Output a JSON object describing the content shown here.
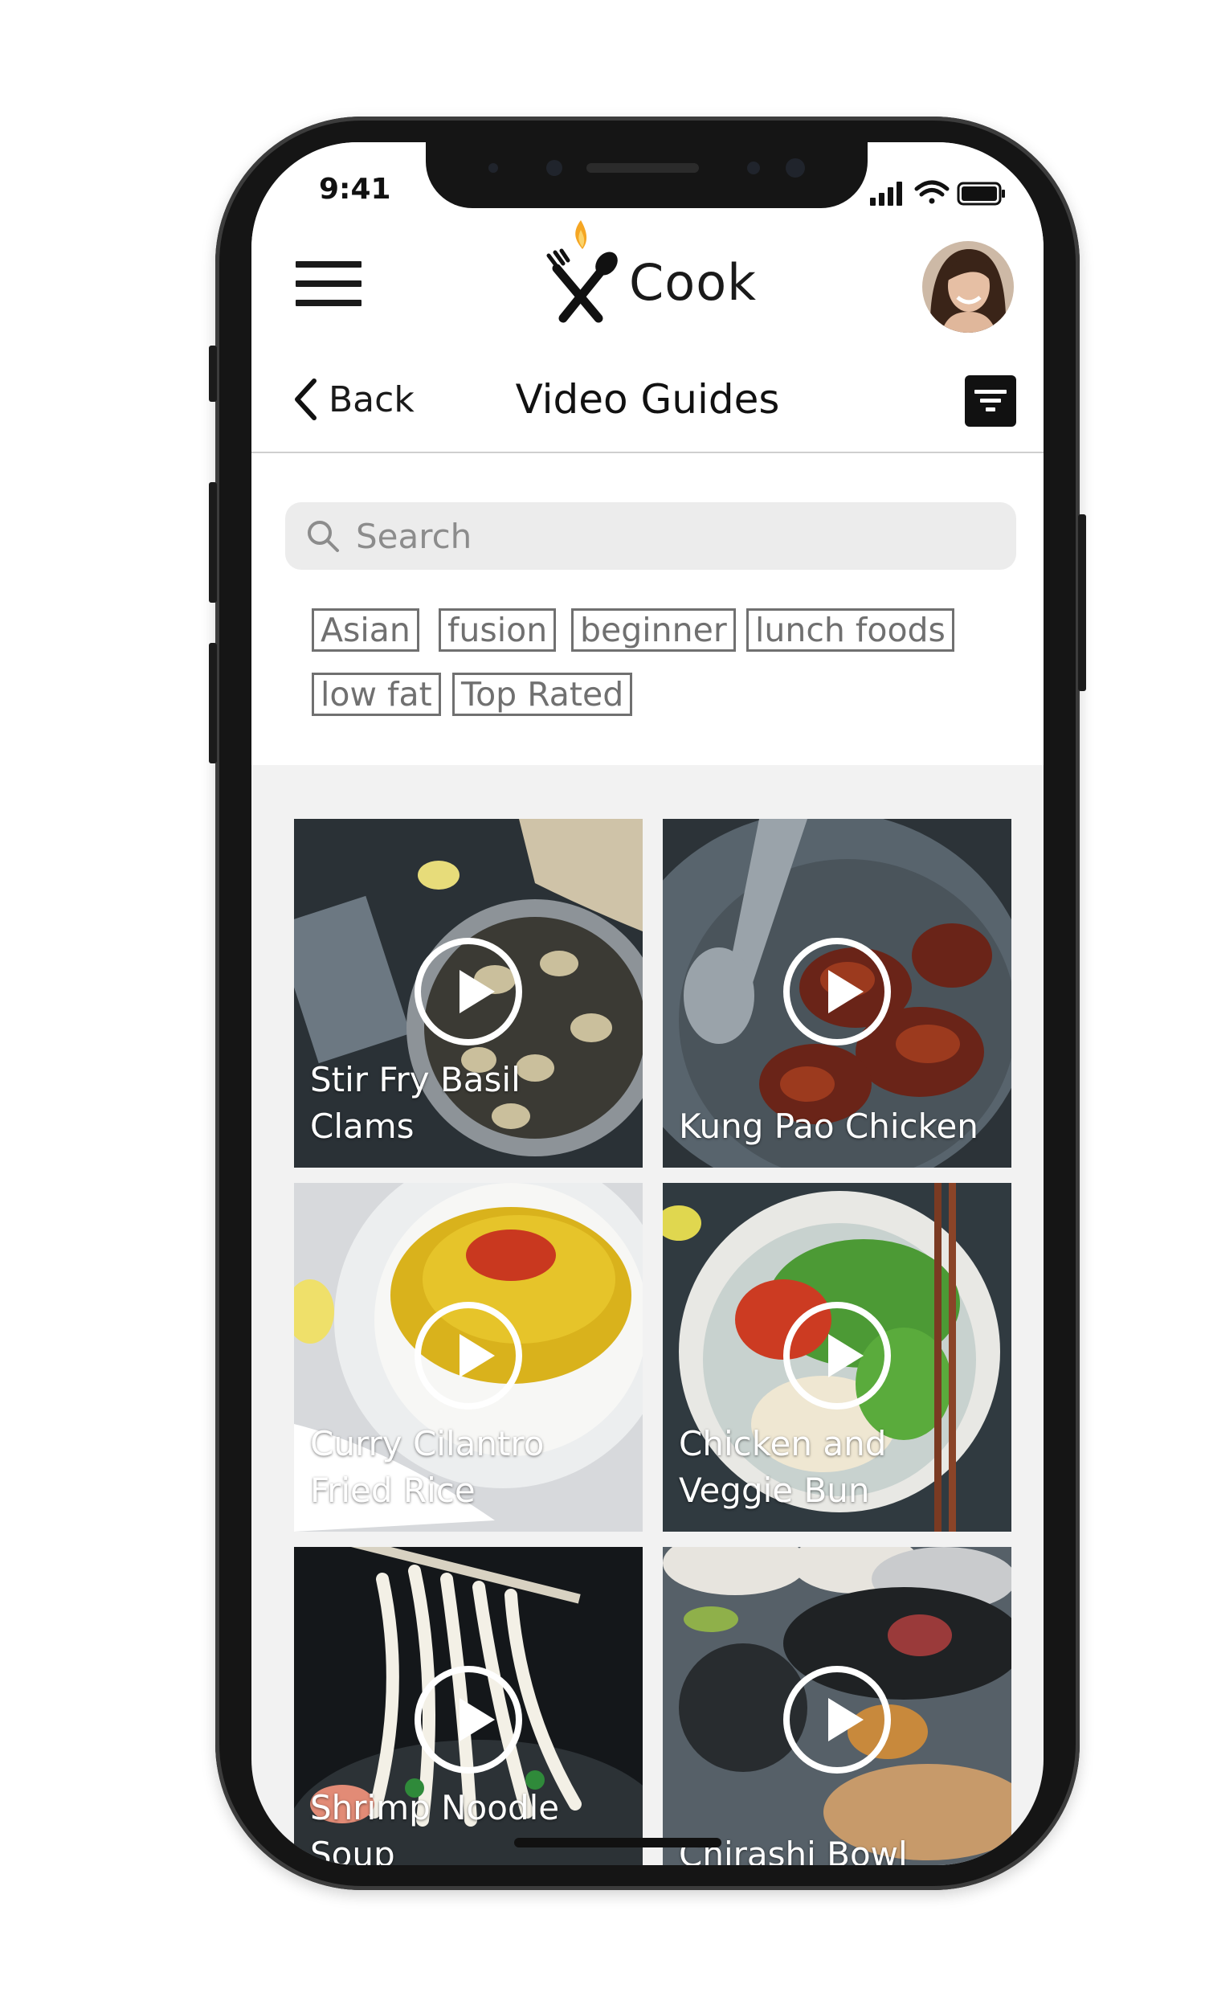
{
  "status_bar": {
    "time": "9:41"
  },
  "app": {
    "name": "Cook"
  },
  "nav": {
    "back_label": "Back",
    "title": "Video Guides"
  },
  "search": {
    "placeholder": "Search"
  },
  "tags": [
    "Asian",
    "fusion",
    "beginner",
    "lunch foods",
    "low fat",
    "Top Rated"
  ],
  "videos": [
    {
      "title": "Stir Fry Basil Clams"
    },
    {
      "title": "Kung Pao Chicken"
    },
    {
      "title": "Curry Cilantro Fried Rice"
    },
    {
      "title": "Chicken and Veggie Bun"
    },
    {
      "title": "Shrimp Noodle Soup"
    },
    {
      "title": "Chirashi Bowl"
    }
  ],
  "icons": {
    "menu": "hamburger-icon",
    "logo": "fork-spoon-flame-icon",
    "back": "chevron-left-icon",
    "filter": "filter-icon",
    "search": "search-icon",
    "play": "play-icon",
    "signal": "signal-icon",
    "wifi": "wifi-icon",
    "battery": "battery-icon"
  },
  "colors": {
    "accent": "#f5a623",
    "text": "#1a1a1a",
    "tag_border": "#707070"
  }
}
